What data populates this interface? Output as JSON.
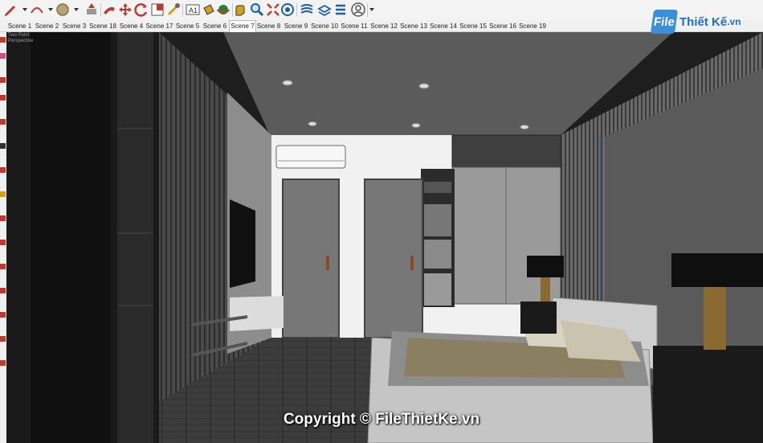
{
  "toolbar": {
    "tools": [
      {
        "icon": "pencil-icon",
        "color": "#c0392b"
      },
      {
        "icon": "dropdown-arrow-icon",
        "color": "#333333"
      },
      {
        "icon": "arc-icon",
        "color": "#c0392b"
      },
      {
        "icon": "dropdown-arrow-icon",
        "color": "#333333"
      },
      {
        "icon": "circle-icon",
        "color": "#8a6d3b"
      },
      {
        "icon": "dropdown-arrow-icon",
        "color": "#333333"
      },
      {
        "icon": "push-pull-icon",
        "color": "#c0392b"
      },
      {
        "icon": "follow-me-icon",
        "color": "#c0392b"
      },
      {
        "icon": "move-icon",
        "color": "#c0392b"
      },
      {
        "icon": "rotate-icon",
        "color": "#c0392b"
      },
      {
        "icon": "scale-icon",
        "color": "#c0392b"
      },
      {
        "icon": "tape-measure-icon",
        "color": "#d4a017"
      },
      {
        "icon": "text-label-icon",
        "color": "#333333"
      },
      {
        "icon": "paint-bucket-icon",
        "color": "#d4a017"
      },
      {
        "icon": "orbit-icon",
        "color": "#c0392b"
      },
      {
        "icon": "pan-icon",
        "color": "#d4a017"
      },
      {
        "icon": "zoom-icon",
        "color": "#1f5fa8"
      },
      {
        "icon": "zoom-extents-icon",
        "color": "#c0392b"
      },
      {
        "icon": "warehouse-icon",
        "color": "#1f5fa8"
      },
      {
        "icon": "extension-icon",
        "color": "#1f5fa8"
      },
      {
        "icon": "layers-icon",
        "color": "#1f5fa8"
      },
      {
        "icon": "styles-icon",
        "color": "#1f5fa8"
      },
      {
        "icon": "account-icon",
        "color": "#555555"
      },
      {
        "icon": "dropdown-arrow-icon",
        "color": "#333333"
      }
    ]
  },
  "scenes": {
    "active": "Scene 7",
    "tabs": [
      "Scene 1",
      "Scene 2",
      "Scene 3",
      "Scene 18",
      "Scene 4",
      "Scene 17",
      "Scene 5",
      "Scene 6",
      "Scene 7",
      "Scene 8",
      "Scene 9",
      "Scene 10",
      "Scene 11",
      "Scene 12",
      "Scene 13",
      "Scene 14",
      "Scene 15",
      "Scene 16",
      "Scene 19"
    ]
  },
  "viewport": {
    "camera_label_1": "Two Point",
    "camera_label_2": "Perspective"
  },
  "logo": {
    "mark": "File",
    "name": "Thiết Kế",
    "tld": ".vn"
  },
  "watermark": {
    "text": "Copyright © FileThietKe.vn"
  },
  "colors": {
    "ceiling": "#5a5a5a",
    "floor": "#3b3b3b",
    "wall_white": "#f2f2f2",
    "door": "#6f6f6f",
    "handle": "#8a4a2a",
    "bed_fabric": "#c9c9c4",
    "throw": "#8a7f60",
    "accent_blue": "#1f5fa8"
  }
}
